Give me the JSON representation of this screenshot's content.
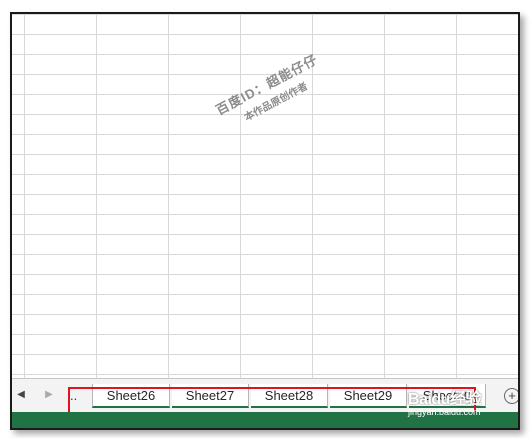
{
  "sheet_tabs": {
    "overflow_indicator": "..",
    "prev_icon": "triangle-left",
    "next_icon": "triangle-right",
    "add_icon": "plus-circle",
    "tabs": [
      "Sheet26",
      "Sheet27",
      "Sheet28",
      "Sheet29",
      "Sheet30"
    ]
  },
  "watermark": {
    "line1": "百度ID：超能仔仔",
    "line2": "本作品原创作者"
  },
  "logo": {
    "text": "Baidu经验",
    "url_text": "jingyan.baidu.com"
  },
  "colors": {
    "accent": "#217346",
    "highlight_border": "#e0141e",
    "gridline": "#d9d9d9"
  }
}
